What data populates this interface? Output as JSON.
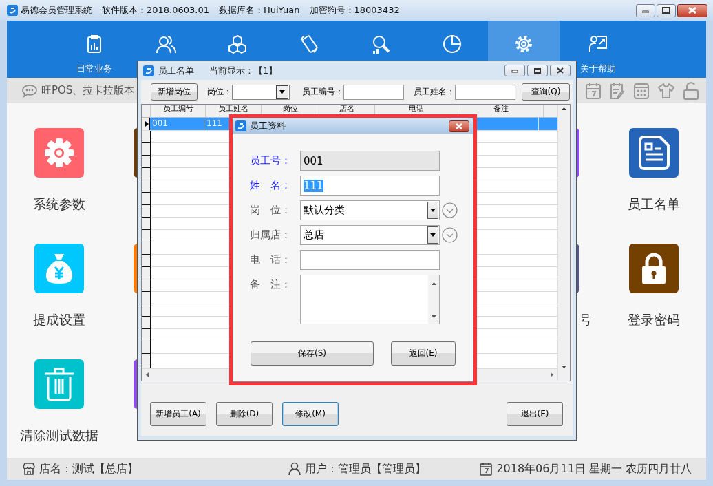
{
  "window": {
    "title": "易德会员管理系统",
    "version": "软件版本：2018.0603.01",
    "database": "数据库名：HuiYuan",
    "dongle": "加密狗号：18003432"
  },
  "nav": [
    {
      "kind": "clipboard",
      "label": "日常业务",
      "selected": false
    },
    {
      "kind": "users",
      "selected": false
    },
    {
      "kind": "cubes",
      "selected": false
    },
    {
      "kind": "phone",
      "selected": false
    },
    {
      "kind": "search",
      "selected": false
    },
    {
      "kind": "pie",
      "selected": false
    },
    {
      "kind": "gear",
      "selected": true
    },
    {
      "kind": "help",
      "label": "关于帮助",
      "selected": false
    }
  ],
  "notice": "旺POS、拉卡拉版本",
  "tile_rows": [
    [
      {
        "kind": "gear",
        "color": "#ff636b",
        "label": "系统参数"
      },
      {
        "kind": "blank",
        "color": "#6b3c0c"
      },
      {
        "kind": "blank",
        "color": "#8c4fe6"
      },
      {
        "kind": "document",
        "color": "#2664b8",
        "label": "员工名单"
      }
    ],
    [
      {
        "kind": "money",
        "color": "#00c8fe",
        "label": "提成设置"
      },
      {
        "kind": "blank",
        "color": "#ff7b00"
      },
      {
        "kind": "blank",
        "color": "#575a82",
        "label": "号"
      },
      {
        "kind": "lock",
        "color": "#734000",
        "label": "登录密码"
      }
    ],
    [
      {
        "kind": "trash",
        "color": "#00c2cc",
        "label": "清除测试数据"
      },
      {
        "kind": "blank",
        "color": "#8c4fe6"
      }
    ]
  ],
  "status_bar": {
    "store": "店名：测试【总店】",
    "user": "用户：管理员【管理员】",
    "date": "2018年06月11日 星期一 农历四月廿八"
  },
  "employee_list": {
    "title": "员工名单",
    "current": "当前显示：【1】",
    "add_position": "新增岗位",
    "position_label": "岗位：",
    "number_label": "员工编号：",
    "name_label": "员工姓名：",
    "query": "查询(Q)",
    "columns": [
      "员工编号",
      "员工姓名",
      "岗位",
      "店名",
      "电话",
      "备注"
    ],
    "rows": [
      {
        "cells": [
          "001",
          "111"
        ],
        "selected": true
      }
    ],
    "buttons": [
      {
        "label": "新增员工(A)",
        "focused": false
      },
      {
        "label": "删除(D)",
        "focused": false
      },
      {
        "label": "修改(M)",
        "focused": true
      },
      {
        "label": "退出(E)",
        "focused": false
      }
    ]
  },
  "employee_form": {
    "title": "员工资料",
    "fields": [
      {
        "kind": "text",
        "label": "员工号：",
        "value": "001",
        "required": true,
        "readonly": true,
        "highlighted": false
      },
      {
        "kind": "text",
        "label": "姓　名：",
        "value": "111",
        "required": true,
        "readonly": false,
        "highlighted": true
      },
      {
        "kind": "select",
        "label": "岗　位：",
        "value": "默认分类",
        "required": false,
        "readonly": false,
        "highlighted": false
      },
      {
        "kind": "select",
        "label": "归属店：",
        "value": "总店",
        "required": false,
        "readonly": false,
        "highlighted": false
      },
      {
        "kind": "text",
        "label": "电　话：",
        "required": false,
        "readonly": false,
        "highlighted": false
      },
      {
        "kind": "textarea",
        "label": "备　注：",
        "required": false,
        "readonly": false,
        "highlighted": false
      }
    ],
    "buttons": [
      "保存(S)",
      "返回(E)"
    ]
  }
}
